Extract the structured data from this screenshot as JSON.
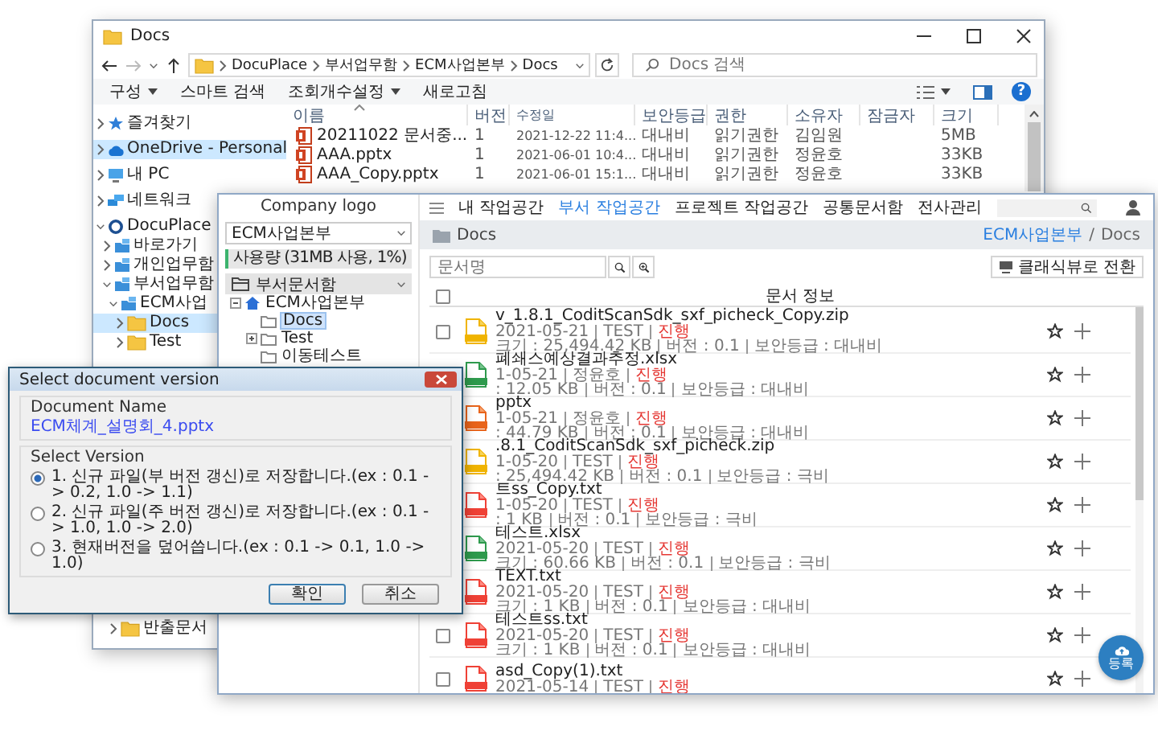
{
  "explorer": {
    "title": "Docs",
    "path": [
      "DocuPlace",
      "부서업무함",
      "ECM사업본부",
      "Docs"
    ],
    "search": {
      "placeholder": "Docs 검색"
    },
    "toolbar": [
      {
        "label": "구성",
        "dropdown": true
      },
      {
        "label": "스마트 검색",
        "dropdown": false
      },
      {
        "label": "조회개수설정",
        "dropdown": true
      },
      {
        "label": "새로고침",
        "dropdown": false
      }
    ],
    "help": "?",
    "nav": [
      {
        "label": "즐겨찾기",
        "expanded": false,
        "selected": false
      },
      {
        "label": "OneDrive - Personal",
        "expanded": false,
        "selected": true
      },
      {
        "label": "내 PC",
        "expanded": false,
        "selected": false
      },
      {
        "label": "네트워크",
        "expanded": false,
        "selected": false
      },
      {
        "label": "DocuPlace",
        "expanded": true,
        "selected": false,
        "children": [
          {
            "label": "바로가기",
            "expanded": false,
            "selected": false
          },
          {
            "label": "개인업무함",
            "expanded": false,
            "selected": false
          },
          {
            "label": "부서업무함",
            "expanded": true,
            "selected": false,
            "children": [
              {
                "label": "ECM사업",
                "expanded": true,
                "selected": false,
                "children": [
                  {
                    "label": "Docs",
                    "expanded": false,
                    "selected": true
                  },
                  {
                    "label": "Test",
                    "expanded": false,
                    "selected": false
                  }
                ]
              }
            ]
          }
        ]
      }
    ],
    "nav_lower": [
      {
        "label": "반출문서"
      }
    ],
    "columns": [
      "이름",
      "버전",
      "수정일",
      "보안등급",
      "권한",
      "소유자",
      "잠금자",
      "크기"
    ],
    "rows": [
      {
        "name": "20211022 문서중...",
        "version": "1",
        "modified": "2021-12-22 11:4...",
        "security": "대내비",
        "permission": "읽기권한",
        "owner": "김임원",
        "size": "5MB"
      },
      {
        "name": "AAA.pptx",
        "version": "1",
        "modified": "2021-06-01 10:4...",
        "security": "대내비",
        "permission": "읽기권한",
        "owner": "정윤호",
        "size": "33KB"
      },
      {
        "name": "AAA_Copy.pptx",
        "version": "1",
        "modified": "2021-06-01 15:1...",
        "security": "대내비",
        "permission": "읽기권한",
        "owner": "정윤호",
        "size": "33KB"
      }
    ]
  },
  "web": {
    "logo": "Company logo",
    "department": "ECM사업본부",
    "usage": "사용량 (31MB 사용, 1%)",
    "section": {
      "label": "부서문서함",
      "expanded": true
    },
    "tree": [
      {
        "label": "ECM사업본부",
        "expanded": true,
        "selected": false,
        "children": [
          {
            "label": "Docs",
            "selected": true
          },
          {
            "label": "Test",
            "expanded": false,
            "selected": false
          },
          {
            "label": "이동테스트",
            "selected": false
          }
        ]
      }
    ],
    "nav": [
      {
        "label": "내 작업공간",
        "selected": false
      },
      {
        "label": "부서 작업공간",
        "selected": true
      },
      {
        "label": "프로젝트 작업공간",
        "selected": false
      },
      {
        "label": "공통문서함",
        "selected": false
      },
      {
        "label": "전사관리",
        "selected": false
      }
    ],
    "header": {
      "title": "Docs",
      "breadcrumb": [
        "ECM사업본부",
        "Docs"
      ],
      "separator": "/"
    },
    "search": {
      "placeholder": "문서명"
    },
    "classic_button": "클래식뷰로 전환",
    "select_all_checked": false,
    "list_header": "문서 정보",
    "documents": [
      {
        "name": "v_1.8.1_CoditScanSdk_sxf_picheck_Copy.zip",
        "kind": "zip",
        "checked": false,
        "date": "2021-05-21",
        "owner": "TEST",
        "status": "진행",
        "size": "크기 : 25,494.42 KB",
        "version": "버전 : 0.1",
        "security": "보안등급 : 대내비"
      },
      {
        "name": "폐쇄스예상결과추정.xlsx",
        "kind": "xlsx",
        "date": "1-05-21",
        "owner": "정윤호",
        "status": "진행",
        "size": ": 12.05 KB",
        "version": "버전 : 0.1",
        "security": "보안등급 : 대내비"
      },
      {
        "name": "pptx",
        "kind": "pptx",
        "date": "1-05-21",
        "owner": "정윤호",
        "status": "진행",
        "size": ": 44.79 KB",
        "version": "버전 : 0.1",
        "security": "보안등급 : 대내비"
      },
      {
        "name": ".8.1_CoditScanSdk_sxf_picheck.zip",
        "kind": "zip",
        "date": "1-05-20",
        "owner": "TEST",
        "status": "진행",
        "size": ": 25,494.42 KB",
        "version": "버전 : 0.1",
        "security": "보안등급 : 극비"
      },
      {
        "name": "트ss_Copy.txt",
        "kind": "txt",
        "date": "1-05-20",
        "owner": "TEST",
        "status": "진행",
        "size": ": 1 KB",
        "version": "버전 : 0.1",
        "security": "보안등급 : 극비"
      },
      {
        "name": "테스트.xlsx",
        "kind": "xlsx",
        "date": "2021-05-20",
        "owner": "TEST",
        "status": "진행",
        "size": "크기 : 60.66 KB",
        "version": "버전 : 0.1",
        "security": "보안등급 : 극비"
      },
      {
        "name": "TEXT.txt",
        "kind": "txt",
        "date": "2021-05-20",
        "owner": "TEST",
        "status": "진행",
        "size": "크기 : 1 KB",
        "version": "버전 : 0.1",
        "security": "보안등급 : 대내비"
      },
      {
        "name": "테스트ss.txt",
        "kind": "txt",
        "checked": false,
        "date": "2021-05-20",
        "owner": "TEST",
        "status": "진행",
        "size": "크기 : 1 KB",
        "version": "버전 : 0.1",
        "security": "보안등급 : 대내비"
      },
      {
        "name": "asd_Copy(1).txt",
        "kind": "txt",
        "checked": false,
        "date": "2021-05-14",
        "owner": "TEST",
        "status": "진행"
      }
    ],
    "fab": "등록"
  },
  "dialog": {
    "title": "Select document version",
    "name_label": "Document Name",
    "name_value": "ECM체계_설명회_4.pptx",
    "version_label": "Select Version",
    "options": [
      {
        "label": "1. 신규 파일(부 버전 갱신)로 저장합니다.(ex : 0.1 -> 0.2, 1.0 -> 1.1)",
        "selected": true
      },
      {
        "label": "2. 신규 파일(주 버전 갱신)로 저장합니다.(ex : 0.1 -> 1.0, 1.0 -> 2.0)",
        "selected": false
      },
      {
        "label": "3. 현재버전을 덮어씁니다.(ex : 0.1 -> 0.1, 1.0 -> 1.0)",
        "selected": false
      }
    ],
    "buttons": [
      {
        "label": "확인",
        "default": true
      },
      {
        "label": "취소",
        "default": false
      }
    ]
  }
}
